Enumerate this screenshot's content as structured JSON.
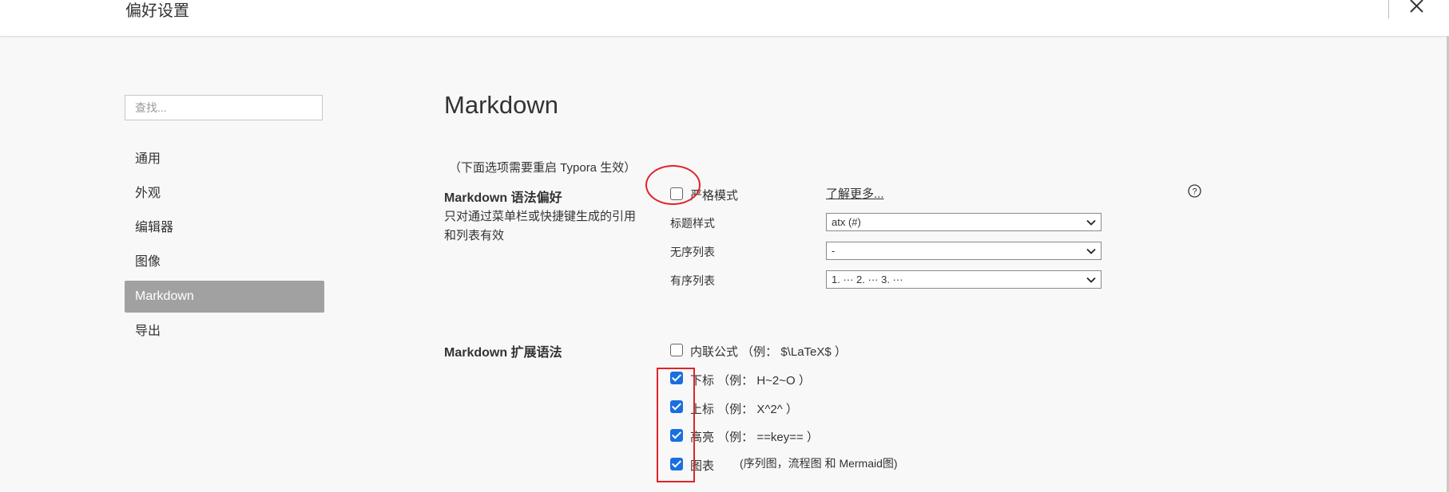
{
  "window": {
    "title": "偏好设置"
  },
  "sidebar": {
    "search_placeholder": "查找...",
    "items": [
      {
        "label": "通用"
      },
      {
        "label": "外观"
      },
      {
        "label": "编辑器"
      },
      {
        "label": "图像"
      },
      {
        "label": "Markdown",
        "active": true
      },
      {
        "label": "导出"
      }
    ]
  },
  "content": {
    "title": "Markdown",
    "restart_note": "（下面选项需要重启 Typora 生效）",
    "syntax_pref": {
      "title": "Markdown 语法偏好",
      "description": "只对通过菜单栏或快捷键生成的引用和列表有效",
      "strict_mode": {
        "label": "严格模式",
        "checked": false
      },
      "learn_more": "了解更多...",
      "heading_style": {
        "label": "标题样式",
        "value": "atx (#)"
      },
      "unordered_list": {
        "label": "无序列表",
        "value": "-"
      },
      "ordered_list": {
        "label": "有序列表",
        "value": "1. ··· 2. ··· 3. ···"
      }
    },
    "extended_syntax": {
      "title": "Markdown 扩展语法",
      "options": [
        {
          "label": "内联公式 （例： $\\LaTeX$ ）",
          "checked": false
        },
        {
          "label": "下标 （例： H~2~O ）",
          "checked": true
        },
        {
          "label": "上标 （例： X^2^ ）",
          "checked": true
        },
        {
          "label": "高亮 （例： ==key== ）",
          "checked": true
        },
        {
          "label": "图表",
          "checked": true
        }
      ],
      "diagram_note": "(序列图，流程图 和 Mermaid图)"
    }
  },
  "colors": {
    "accent": "#1a6fe0",
    "annotation": "#e0242a",
    "nav_active_bg": "#a1a1a1"
  }
}
